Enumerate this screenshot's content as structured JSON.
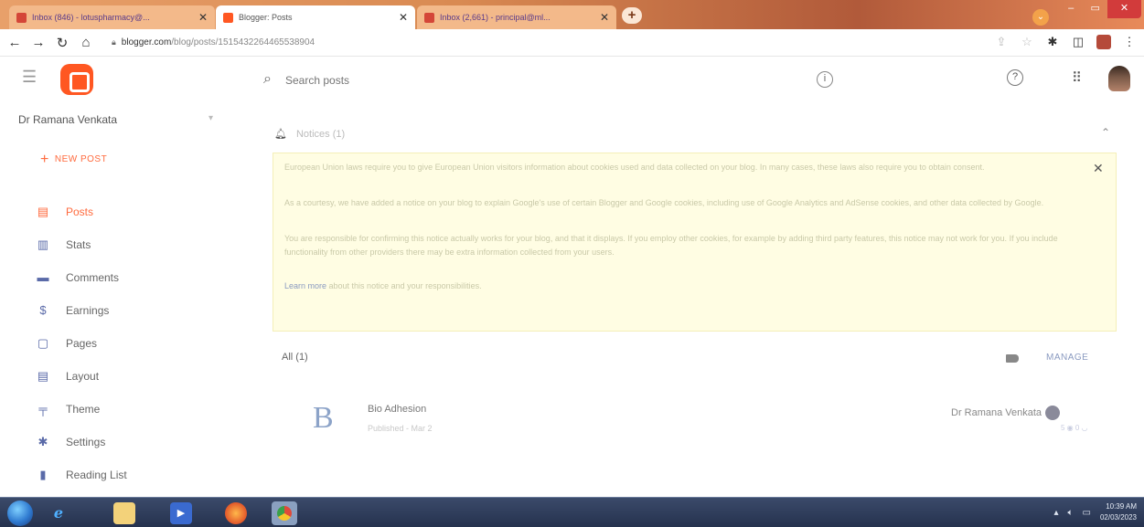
{
  "browser": {
    "tabs": [
      {
        "label": "Inbox (846) - lotusp​harmacy@...",
        "favicon_color": "#d44638"
      },
      {
        "label": "Blogger: Posts",
        "favicon_color": "#ff5722"
      },
      {
        "label": "Inbox (2,661) - principal@ml...",
        "favicon_color": "#d44638"
      }
    ],
    "new_tab": "+",
    "tab_menu": "⌄",
    "address": {
      "host": "blogger.com",
      "path": "/blog/posts/1515432264465538904"
    }
  },
  "header": {
    "search_placeholder": "Search posts"
  },
  "sidebar": {
    "blog_name": "Dr Ramana Venkata",
    "new_post": "NEW POST",
    "items": [
      {
        "label": "Posts",
        "icon": "posts-icon",
        "glyph": "▤"
      },
      {
        "label": "Stats",
        "icon": "stats-icon",
        "glyph": "▥"
      },
      {
        "label": "Comments",
        "icon": "comments-icon",
        "glyph": "▬"
      },
      {
        "label": "Earnings",
        "icon": "earnings-icon",
        "glyph": "$"
      },
      {
        "label": "Pages",
        "icon": "pages-icon",
        "glyph": "▢"
      },
      {
        "label": "Layout",
        "icon": "layout-icon",
        "glyph": "▤"
      },
      {
        "label": "Theme",
        "icon": "theme-icon",
        "glyph": "╤"
      },
      {
        "label": "Settings",
        "icon": "settings-icon",
        "glyph": "✱"
      },
      {
        "label": "Reading List",
        "icon": "reading-list-icon",
        "glyph": "▮"
      }
    ]
  },
  "notices": {
    "title": "Notices (1)",
    "paragraphs": [
      "European Union laws require you to give European Union visitors information about cookies used and data collected on your blog. In many cases, these laws also require you to obtain consent.",
      "As a courtesy, we have added a notice on your blog to explain Google's use of certain Blogger and Google cookies, including use of Google Analytics and AdSense cookies, and other data collected by Google.",
      "You are responsible for confirming this notice actually works for your blog, and that it displays. If you employ other cookies, for example by adding third party features, this notice may not work for you. If you include functionality from other providers there may be extra information collected from your users."
    ],
    "learn_more_link": "Learn more",
    "learn_more_rest": " about this notice and your responsibilities."
  },
  "posts": {
    "filter_label": "All (1)",
    "manage_label": "MANAGE",
    "list": [
      {
        "thumb_letter": "B",
        "title": "Bio Adhesion",
        "status": "Published - Mar 2",
        "author": "Dr Ramana Venkata",
        "stats": "5 ◉   0 ◡"
      }
    ]
  },
  "taskbar": {
    "time": "10:39 AM",
    "date": "02/03/2023"
  }
}
